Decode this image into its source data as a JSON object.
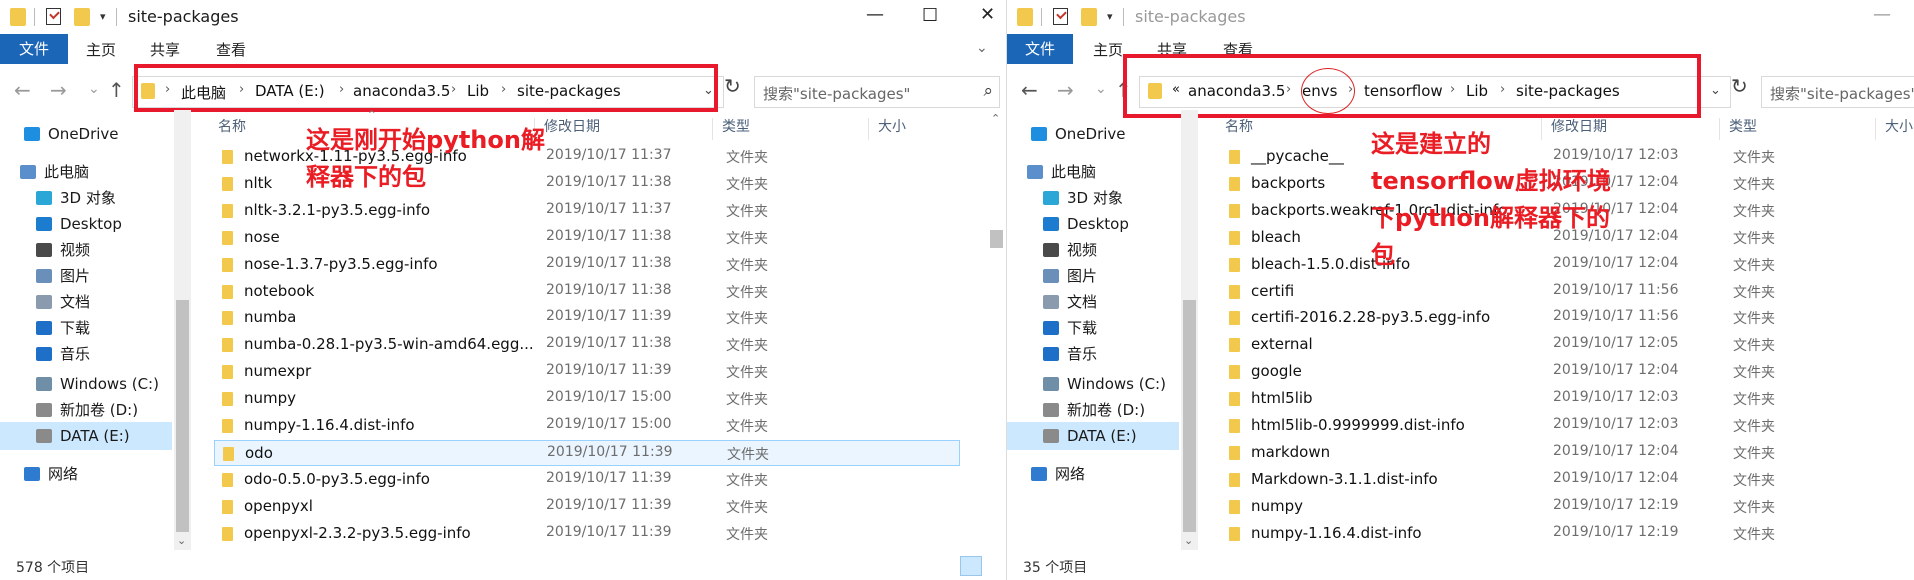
{
  "left": {
    "title": "site-packages",
    "ribbon_tabs": [
      "文件",
      "主页",
      "共享",
      "查看"
    ],
    "breadcrumbs": [
      "此电脑",
      "DATA (E:)",
      "anaconda3.5",
      "Lib",
      "site-packages"
    ],
    "search_placeholder": "搜索\"site-packages\"",
    "columns": [
      "名称",
      "修改日期",
      "类型",
      "大小"
    ],
    "sidebar": [
      {
        "label": "OneDrive",
        "icon": "cloud-icon"
      },
      {
        "label": "此电脑",
        "icon": "computer-icon"
      },
      {
        "label": "3D 对象",
        "icon": "3d-objects-icon"
      },
      {
        "label": "Desktop",
        "icon": "desktop-icon"
      },
      {
        "label": "视频",
        "icon": "video-icon"
      },
      {
        "label": "图片",
        "icon": "pictures-icon"
      },
      {
        "label": "文档",
        "icon": "documents-icon"
      },
      {
        "label": "下载",
        "icon": "download-icon"
      },
      {
        "label": "音乐",
        "icon": "music-icon"
      },
      {
        "label": "Windows (C:)",
        "icon": "drive-c-icon"
      },
      {
        "label": "新加卷 (D:)",
        "icon": "drive-d-icon"
      },
      {
        "label": "DATA (E:)",
        "icon": "drive-e-icon"
      },
      {
        "label": "网络",
        "icon": "network-icon"
      }
    ],
    "files": [
      {
        "name": "networkx-1.11-py3.5.egg-info",
        "date": "2019/10/17 11:37",
        "type": "文件夹"
      },
      {
        "name": "nltk",
        "date": "2019/10/17 11:38",
        "type": "文件夹"
      },
      {
        "name": "nltk-3.2.1-py3.5.egg-info",
        "date": "2019/10/17 11:37",
        "type": "文件夹"
      },
      {
        "name": "nose",
        "date": "2019/10/17 11:38",
        "type": "文件夹"
      },
      {
        "name": "nose-1.3.7-py3.5.egg-info",
        "date": "2019/10/17 11:38",
        "type": "文件夹"
      },
      {
        "name": "notebook",
        "date": "2019/10/17 11:38",
        "type": "文件夹"
      },
      {
        "name": "numba",
        "date": "2019/10/17 11:39",
        "type": "文件夹"
      },
      {
        "name": "numba-0.28.1-py3.5-win-amd64.egg...",
        "date": "2019/10/17 11:38",
        "type": "文件夹"
      },
      {
        "name": "numexpr",
        "date": "2019/10/17 11:39",
        "type": "文件夹"
      },
      {
        "name": "numpy",
        "date": "2019/10/17 15:00",
        "type": "文件夹"
      },
      {
        "name": "numpy-1.16.4.dist-info",
        "date": "2019/10/17 15:00",
        "type": "文件夹"
      },
      {
        "name": "odo",
        "date": "2019/10/17 11:39",
        "type": "文件夹"
      },
      {
        "name": "odo-0.5.0-py3.5.egg-info",
        "date": "2019/10/17 11:39",
        "type": "文件夹"
      },
      {
        "name": "openpyxl",
        "date": "2019/10/17 11:39",
        "type": "文件夹"
      },
      {
        "name": "openpyxl-2.3.2-py3.5.egg-info",
        "date": "2019/10/17 11:39",
        "type": "文件夹"
      }
    ],
    "annotation": [
      "这是刚开始python解",
      "释器下的包"
    ],
    "status_count": "578 个项目"
  },
  "right": {
    "title": "site-packages",
    "ribbon_tabs": [
      "文件",
      "主页",
      "共享",
      "查看"
    ],
    "breadcrumbs": [
      "«",
      "anaconda3.5",
      "envs",
      "tensorflow",
      "Lib",
      "site-packages"
    ],
    "search_placeholder": "搜索\"site-packages\"",
    "columns": [
      "名称",
      "修改日期",
      "类型",
      "大小"
    ],
    "sidebar": [
      {
        "label": "OneDrive",
        "icon": "cloud-icon"
      },
      {
        "label": "此电脑",
        "icon": "computer-icon"
      },
      {
        "label": "3D 对象",
        "icon": "3d-objects-icon"
      },
      {
        "label": "Desktop",
        "icon": "desktop-icon"
      },
      {
        "label": "视频",
        "icon": "video-icon"
      },
      {
        "label": "图片",
        "icon": "pictures-icon"
      },
      {
        "label": "文档",
        "icon": "documents-icon"
      },
      {
        "label": "下载",
        "icon": "download-icon"
      },
      {
        "label": "音乐",
        "icon": "music-icon"
      },
      {
        "label": "Windows (C:)",
        "icon": "drive-c-icon"
      },
      {
        "label": "新加卷 (D:)",
        "icon": "drive-d-icon"
      },
      {
        "label": "DATA (E:)",
        "icon": "drive-e-icon"
      },
      {
        "label": "网络",
        "icon": "network-icon"
      }
    ],
    "files": [
      {
        "name": "__pycache__",
        "date": "2019/10/17 12:03",
        "type": "文件夹"
      },
      {
        "name": "backports",
        "date": "2019/10/17 12:04",
        "type": "文件夹"
      },
      {
        "name": "backports.weakref-1.0rc1.dist-info",
        "date": "2019/10/17 12:04",
        "type": "文件夹"
      },
      {
        "name": "bleach",
        "date": "2019/10/17 12:04",
        "type": "文件夹"
      },
      {
        "name": "bleach-1.5.0.dist-info",
        "date": "2019/10/17 12:04",
        "type": "文件夹"
      },
      {
        "name": "certifi",
        "date": "2019/10/17 11:56",
        "type": "文件夹"
      },
      {
        "name": "certifi-2016.2.28-py3.5.egg-info",
        "date": "2019/10/17 11:56",
        "type": "文件夹"
      },
      {
        "name": "external",
        "date": "2019/10/17 12:05",
        "type": "文件夹"
      },
      {
        "name": "google",
        "date": "2019/10/17 12:04",
        "type": "文件夹"
      },
      {
        "name": "html5lib",
        "date": "2019/10/17 12:03",
        "type": "文件夹"
      },
      {
        "name": "html5lib-0.9999999.dist-info",
        "date": "2019/10/17 12:03",
        "type": "文件夹"
      },
      {
        "name": "markdown",
        "date": "2019/10/17 12:04",
        "type": "文件夹"
      },
      {
        "name": "Markdown-3.1.1.dist-info",
        "date": "2019/10/17 12:04",
        "type": "文件夹"
      },
      {
        "name": "numpy",
        "date": "2019/10/17 12:19",
        "type": "文件夹"
      },
      {
        "name": "numpy-1.16.4.dist-info",
        "date": "2019/10/17 12:19",
        "type": "文件夹"
      }
    ],
    "annotation": [
      "这是建立的",
      "tensorflow虚拟环境",
      "下python解释器下的",
      "包"
    ],
    "status_count": "35 个项目"
  },
  "colors": {
    "accent": "#1c66b8",
    "annotation": "#e8192c",
    "folder": "#f2c94c",
    "selection": "#cce8ff"
  }
}
